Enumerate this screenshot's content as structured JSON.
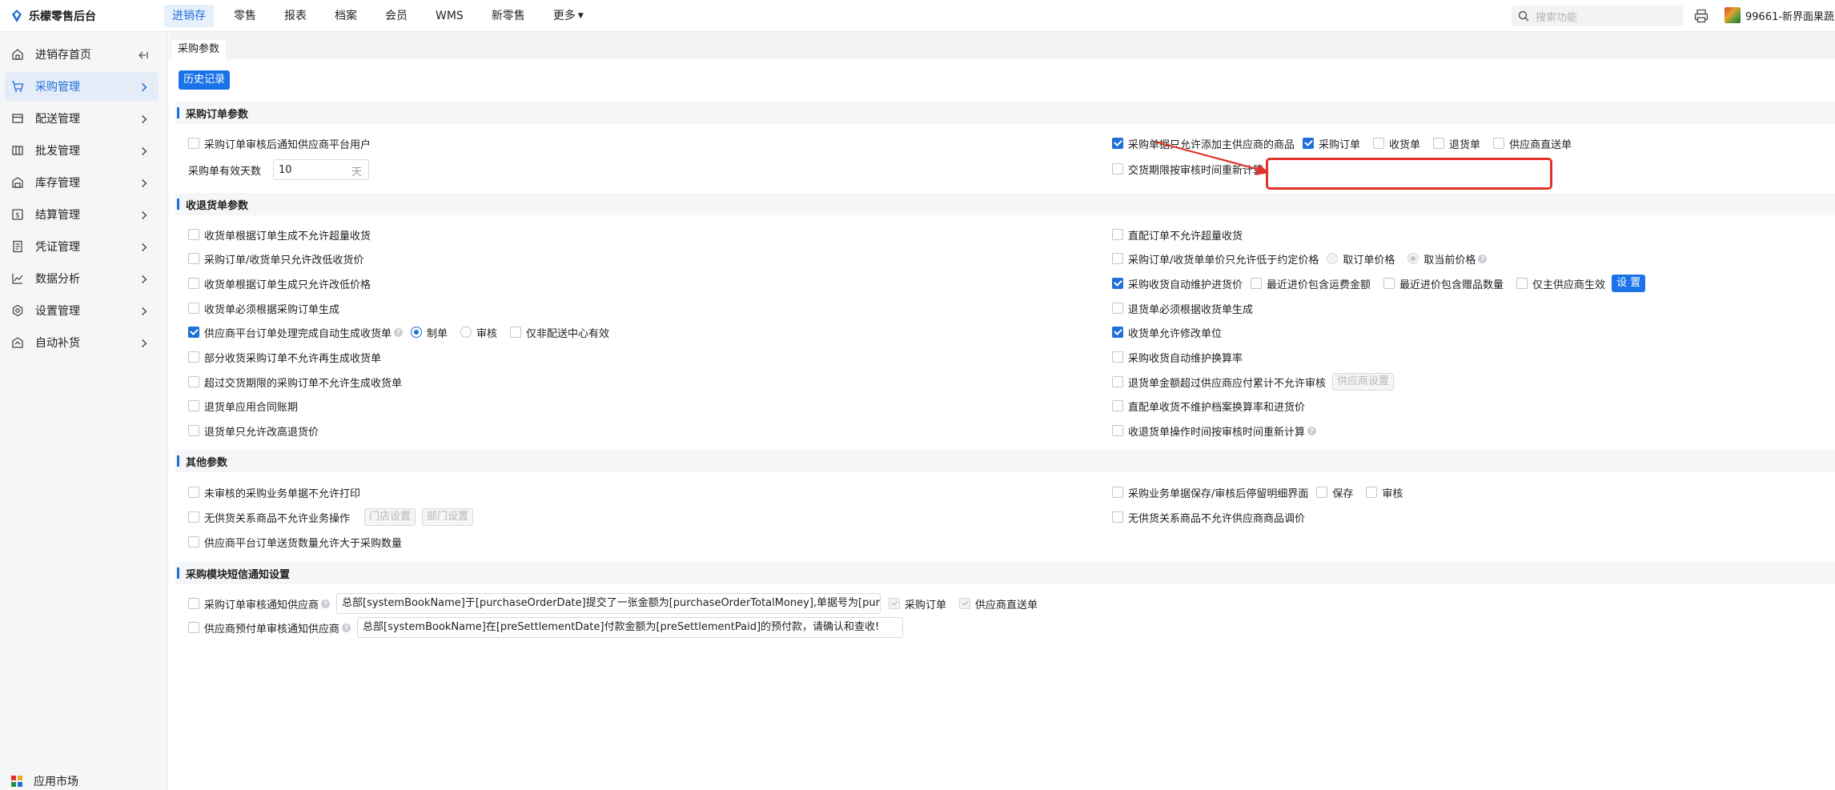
{
  "app": {
    "title": "乐檬零售后台"
  },
  "nav": [
    {
      "label": "进销存",
      "active": true
    },
    {
      "label": "零售"
    },
    {
      "label": "报表"
    },
    {
      "label": "档案"
    },
    {
      "label": "会员"
    },
    {
      "label": "WMS"
    },
    {
      "label": "新零售"
    },
    {
      "label": "更多"
    }
  ],
  "search": {
    "placeholder": "搜索功能"
  },
  "user": {
    "name": "99661-新界面果蔬"
  },
  "sidebar": {
    "items": [
      {
        "label": "进销存首页"
      },
      {
        "label": "采购管理",
        "active": true
      },
      {
        "label": "配送管理"
      },
      {
        "label": "批发管理"
      },
      {
        "label": "库存管理"
      },
      {
        "label": "结算管理"
      },
      {
        "label": "凭证管理"
      },
      {
        "label": "数据分析"
      },
      {
        "label": "设置管理"
      },
      {
        "label": "自动补货"
      }
    ],
    "market": "应用市场"
  },
  "page": {
    "tab": "采购参数",
    "history_button": "历史记录",
    "sections": {
      "order": "采购订单参数",
      "receive": "收退货单参数",
      "other": "其他参数",
      "sms": "采购模块短信通知设置"
    },
    "order": {
      "notify_supplier": "采购订单审核后通知供应商平台用户",
      "valid_days_label": "采购单有效天数",
      "valid_days_value": "10",
      "valid_days_unit": "天",
      "main_supplier_only": "采购单据只允许添加主供应商的商品",
      "opt_purchase_order": "采购订单",
      "opt_receipt": "收货单",
      "opt_return": "退货单",
      "opt_direct": "供应商直送单",
      "recalc_delivery": "交货期限按审核时间重新计算"
    },
    "receive": {
      "left": [
        "收货单根据订单生成不允许超量收货",
        "采购订单/收货单只允许改低收货价",
        "收货单根据订单生成只允许改低价格",
        "收货单必须根据采购订单生成",
        "供应商平台订单处理完成自动生成收货单",
        "部分收货采购订单不允许再生成收货单",
        "超过交货期限的采购订单不允许生成收货单",
        "退货单应用合同账期",
        "退货单只允许改高退货价"
      ],
      "auto_gen_opt_make": "制单",
      "auto_gen_opt_audit": "审核",
      "auto_gen_opt_nondc": "仅非配送中心有效",
      "right": [
        "直配订单不允许超量收货",
        "采购订单/收货单单价只允许低于约定价格",
        "采购收货自动维护进货价",
        "退货单必须根据收货单生成",
        "收货单允许修改单位",
        "采购收货自动维护换算率",
        "退货单金额超过供应商应付累计不允许审核",
        "直配单收货不维护档案换算率和进货价",
        "收退货单操作时间按审核时间重新计算"
      ],
      "price_opt_order": "取订单价格",
      "price_opt_current": "取当前价格",
      "maintain_opt_freight": "最近进价包含运费金额",
      "maintain_opt_gift": "最近进价包含赠品数量",
      "maintain_opt_main": "仅主供应商生效",
      "settings_button": "设 置",
      "supplier_settings_button": "供应商设置"
    },
    "other": {
      "no_print": "未审核的采购业务单据不允许打印",
      "no_supply_ops": "无供货关系商品不允许业务操作",
      "store_settings": "门店设置",
      "dept_settings": "部门设置",
      "over_qty": "供应商平台订单送货数量允许大于采购数量",
      "stay_detail": "采购业务单据保存/审核后停留明细界面",
      "opt_save": "保存",
      "opt_audit": "审核",
      "no_price_adjust": "无供货关系商品不允许供应商商品调价"
    },
    "sms": {
      "order_notify": "采购订单审核通知供应商",
      "order_template": "总部[systemBookName]于[purchaseOrderDate]提交了一张金额为[purchaseOrderTotalMoney],单据号为[purchaseOrderNum]的采购订单",
      "opt_purchase_order": "采购订单",
      "opt_direct": "供应商直送单",
      "prepay_notify": "供应商预付单审核通知供应商",
      "prepay_template": "总部[systemBookName]在[preSettlementDate]付款金额为[preSettlementPaid]的预付款，请确认和查收!"
    }
  },
  "colors": {
    "accent": "#1f6fd8",
    "highlight": "#e0342a"
  }
}
